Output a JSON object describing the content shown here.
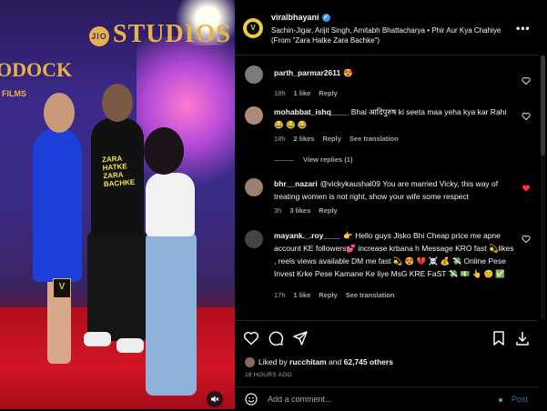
{
  "media": {
    "brand_top": "STUDIOS",
    "brand_jio": "JIO",
    "brand_left": "ODOCK",
    "brand_films": "FILMS",
    "hoodie_text": "ZARA HATKE ZARA BACHKE",
    "watermark": "V",
    "mute_icon": "speaker-muted-icon"
  },
  "header": {
    "username": "viralbhayani",
    "verified": true,
    "audio": "Sachin-Jigar, Arijit Singh, Amitabh Bhattacharya • Phir Aur Kya Chahiye (From \"Zara Hatke Zara Bachke\")",
    "more": "•••"
  },
  "comments": [
    {
      "user": "parth_parmar2611",
      "text": "😍",
      "time": "18h",
      "likes": "1 like",
      "reply": "Reply",
      "liked": false,
      "avatar_color": "#7a7a7a"
    },
    {
      "user": "mohabbat_ishq____",
      "text": "Bhai आदिपुरुष ki seeta maa yeha kya kar Rahi 😂 😂 😂",
      "time": "18h",
      "likes": "2 likes",
      "reply": "Reply",
      "translate": "See translation",
      "liked": false,
      "avatar_color": "#b08a78"
    },
    {
      "user": "bhr__nazari",
      "text": "@vickykaushal09 You are married Vicky, this way of treating women is not right, show your wife some respect",
      "time": "3h",
      "likes": "3 likes",
      "reply": "Reply",
      "liked": true,
      "avatar_color": "#9a8070"
    },
    {
      "user": "mayank._.roy____",
      "text": "👉 Hello guys Jisko Bhi Cheap price me apne account KE followers💕 increase krbana h Message KRO fast 💫likes , reels views available DM me fast 💫 😍 💔 ☠️ 💰 💸 Online Pese Invest Krke Pese Kamane Ke liye MsG KRE FaST 💸 💵 👆 😊 ✅",
      "time": "17h",
      "likes": "1 like",
      "reply": "Reply",
      "translate": "See translation",
      "liked": false,
      "avatar_color": "#444"
    }
  ],
  "view_replies": "View replies (1)",
  "actions": {
    "liked_by_prefix": "Liked by",
    "liked_by_user": "rucchitam",
    "liked_by_and": "and",
    "likes_count": "62,745 others",
    "timestamp": "18 HOURS AGO"
  },
  "add_comment": {
    "placeholder": "Add a comment...",
    "post": "Post"
  },
  "colors": {
    "verified": "#3897f0",
    "like_red": "#ff3040",
    "post_blue": "#3d6aa6"
  }
}
